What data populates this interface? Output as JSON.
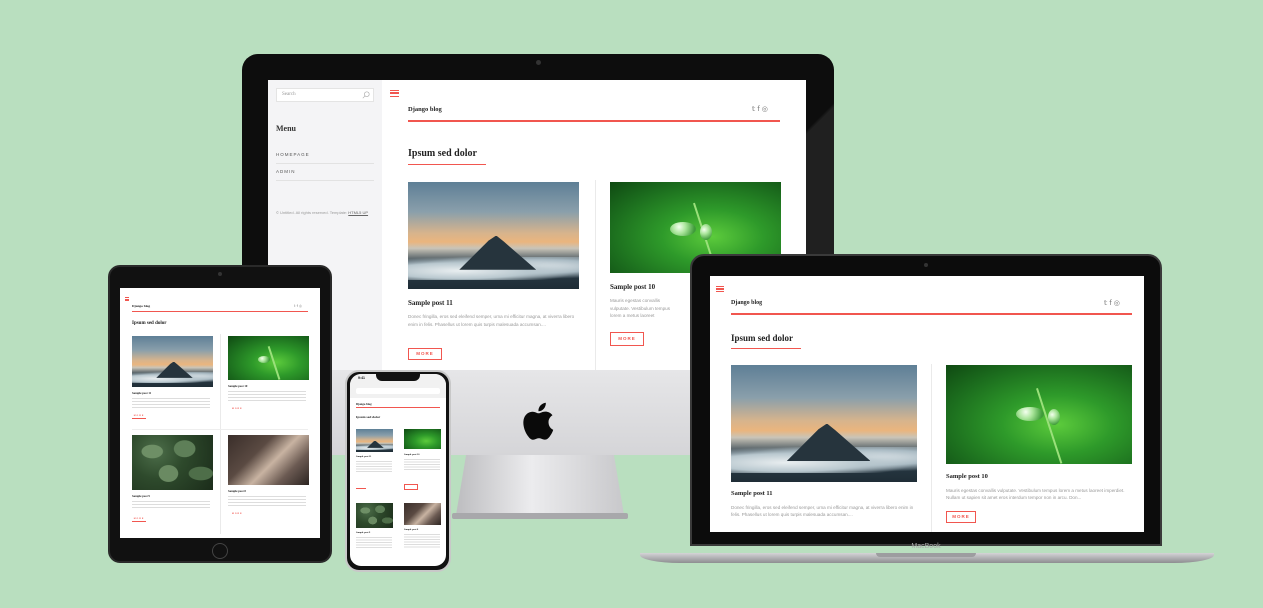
{
  "blog": {
    "search_placeholder": "Search",
    "menu_title": "Menu",
    "nav": [
      "HOMEPAGE",
      "ADMIN"
    ],
    "footer_text": "© Untitled. All rights reserved. Template:",
    "footer_link": "HTML5 UP",
    "site_title": "Django blog",
    "social_icons": [
      "twitter-icon",
      "facebook-icon",
      "instagram-icon"
    ],
    "social_glyphs": [
      "𝕥",
      "f",
      "◎"
    ],
    "section_heading": "Ipsum sed dolor",
    "posts": [
      {
        "title": "Sample post 11",
        "excerpt": "Donec fringilla, eros sed eleifend semper, urna mi efficitur magna, at viverra libero enim in felis. Phasellus ut lorem quis turpis malesuada accumsan....",
        "button": "MORE"
      },
      {
        "title": "Sample post 10",
        "excerpt": "Mauris egestas convallis vulputate. Vestibulum tempus lorem a metus laoreet imperdiet. Nullam ut sapien sit amet eros interdum tempor non in arcu. Don...",
        "button": "MORE"
      },
      {
        "title": "Sample post 9",
        "excerpt": "",
        "button": "MORE"
      },
      {
        "title": "Sample post 8",
        "excerpt": "",
        "button": "MORE"
      }
    ],
    "accent_color": "#f1564f"
  },
  "iphone": {
    "time": "9:41"
  },
  "macbook": {
    "label": "MacBook"
  }
}
